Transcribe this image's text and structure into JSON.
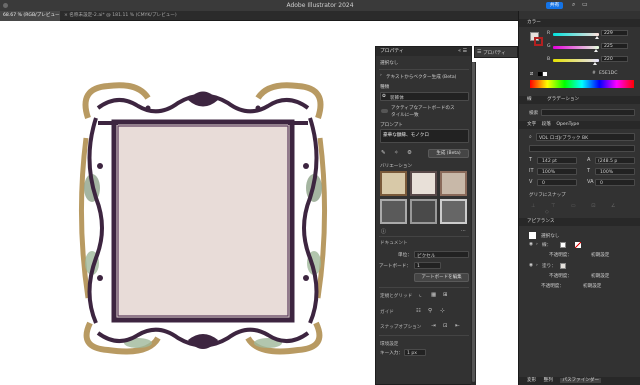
{
  "app": {
    "title": "Adobe Illustrator 2024",
    "share_label": "共有"
  },
  "tabs": [
    {
      "label": "68.67 % (RGB/プレビュー)"
    },
    {
      "label": "× 名称未設定-2.ai* @ 181.11 % (CMYK/プレビュー)"
    }
  ],
  "properties": {
    "title": "プロパティ",
    "selection": "選択なし",
    "text_to_vector": "テキストからベクター生成 (Beta)",
    "type_label": "種類",
    "type_value": "装飾体",
    "artboard_style_line1": "アクティブなアートボードのス",
    "artboard_style_line2": "タイルに一致",
    "prompt_label": "プロンプト",
    "prompt_value": "豪華な額縁、モノクロ",
    "generate_label": "生成 (Beta)",
    "variations_label": "バリエーション",
    "document_label": "ドキュメント",
    "unit_label": "単位：",
    "unit_value": "ピクセル",
    "artboard_label": "アートボード：",
    "artboard_value": "1",
    "edit_artboard": "アートボードを編集",
    "rulers_grids": "定規とグリッド",
    "guides": "ガイド",
    "snap_options": "スナップオプション",
    "preferences": "環境設定",
    "key_increment_label": "キー入力：",
    "key_increment_value": "1 px"
  },
  "secondary_panel": {
    "title": "プロパティ"
  },
  "color_panel": {
    "title": "カラー",
    "r_label": "R",
    "r_value": "229",
    "g_label": "G",
    "g_value": "225",
    "b_label": "B",
    "b_value": "220",
    "hex": "E5E1DC",
    "fill_color": "#e5e1dc",
    "stroke_color": "#b32020"
  },
  "gradient_tabs": {
    "tab1": "線",
    "tab2": "グラデーション"
  },
  "char_panel": {
    "tab_char": "文字",
    "tab_para": "段落",
    "tab_opentype": "OpenType",
    "search_label": "検索",
    "font_name": "VDL ロゴJrブラック BK",
    "font_size": "142 pt",
    "leading": "(248.5 p",
    "vscale": "100%",
    "hscale": "100%",
    "kerning": "0",
    "tracking": "0",
    "glyph_snap": "グリフにスナップ"
  },
  "appearance_panel": {
    "title": "アピアランス",
    "selection": "選択なし",
    "stroke_label": "線：",
    "opacity1_label": "不透明度：",
    "opacity1_value": "初期設定",
    "fill_label": "塗り：",
    "opacity2_label": "不透明度：",
    "opacity2_value": "初期設定",
    "opacity3_label": "不透明度：",
    "opacity3_value": "初期設定"
  },
  "bottom_tabs": {
    "tab1": "変形",
    "tab2": "整列",
    "tab3": "パスファインダー"
  },
  "colors": {
    "frame_fill": "#e8dcd8",
    "frame_dark": "#3d2540",
    "frame_gold": "#b89a62",
    "frame_green": "#8fa38a"
  }
}
